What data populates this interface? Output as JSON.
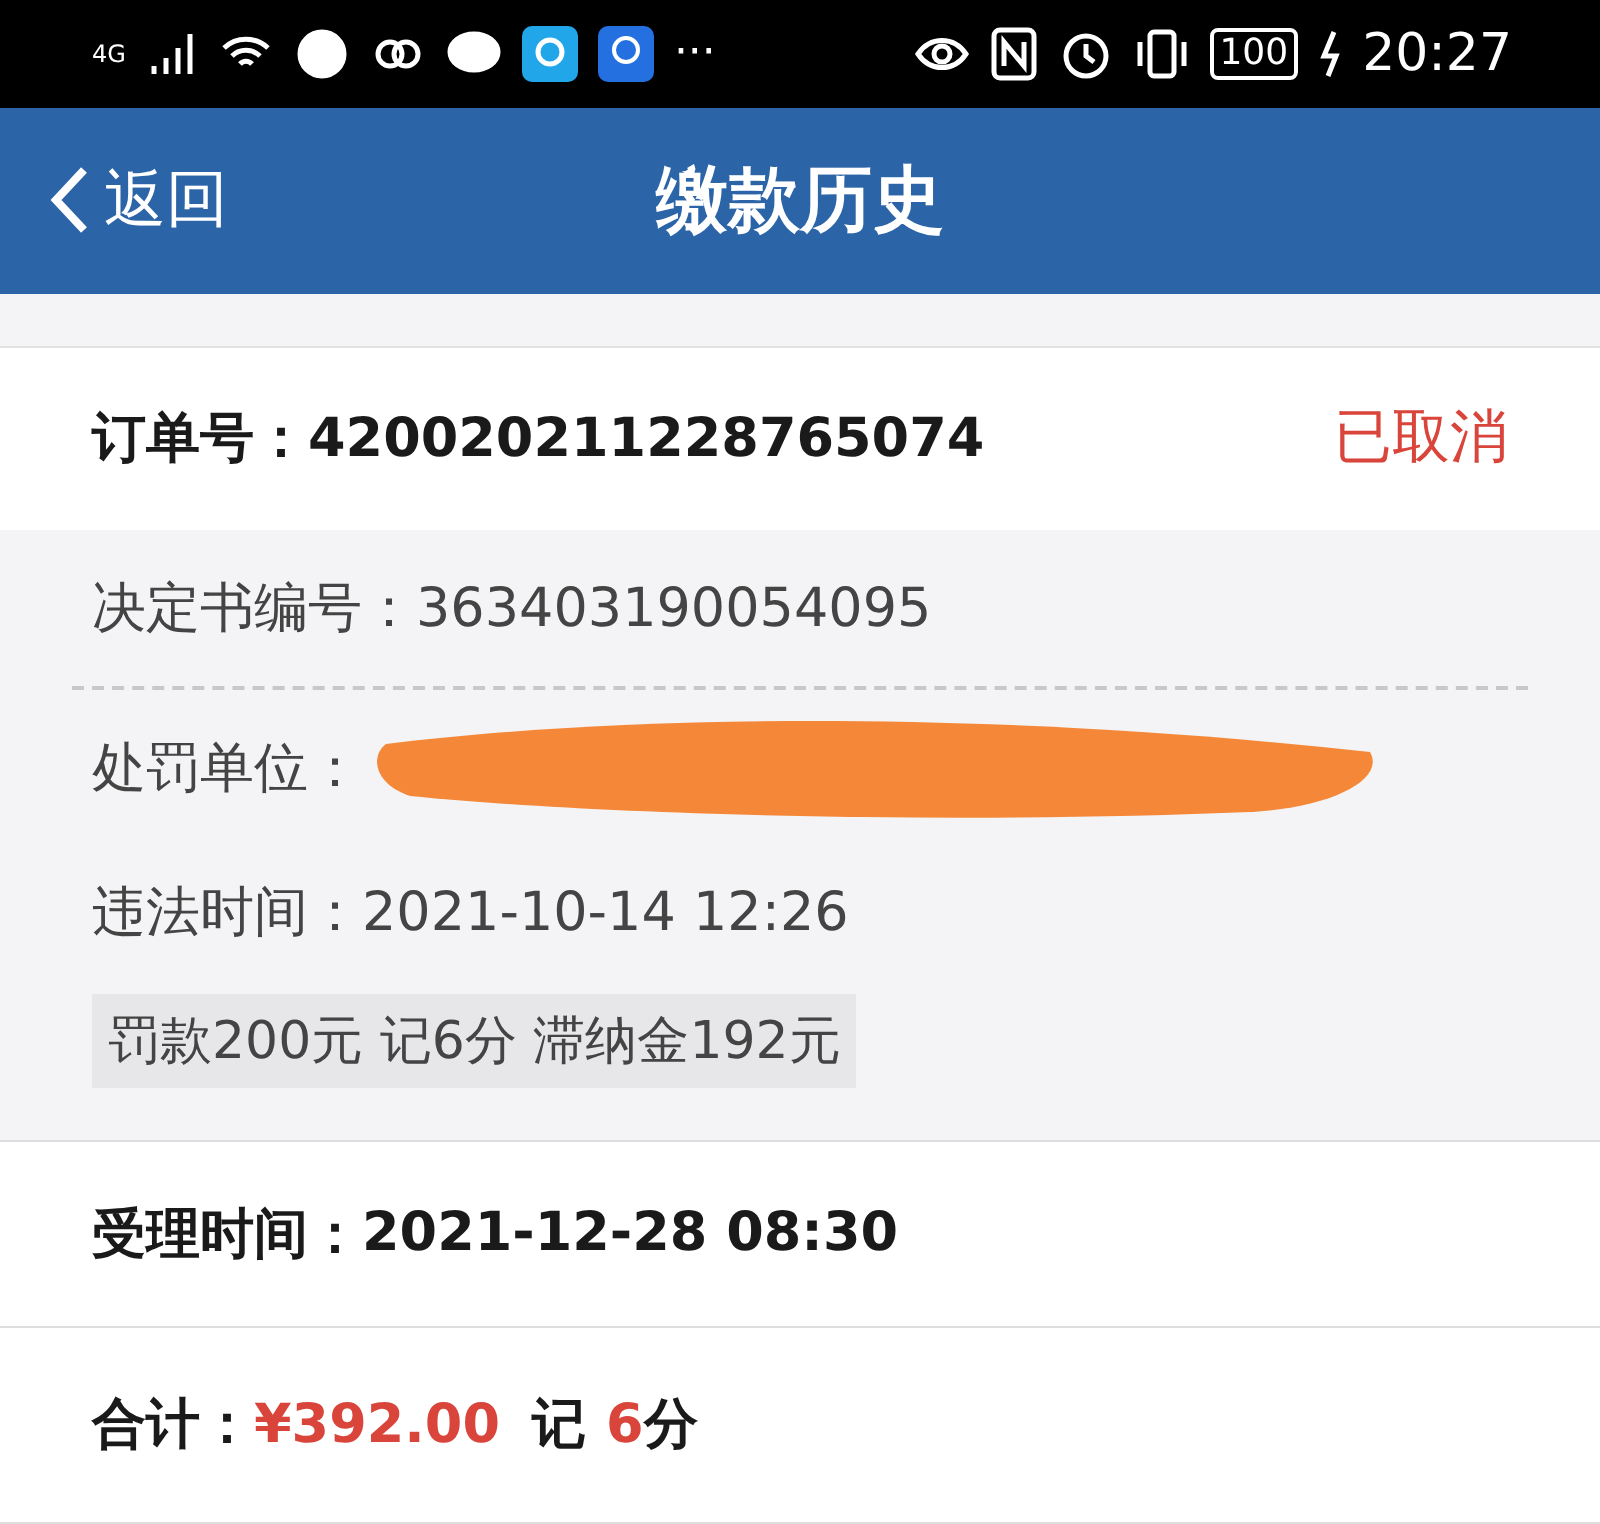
{
  "status_bar": {
    "network": "4G",
    "more": "···",
    "battery": "100",
    "time": "20:27"
  },
  "nav": {
    "back": "返回",
    "title": "缴款历史"
  },
  "order": {
    "label": "订单号：",
    "number": "420020211228765074",
    "status": "已取消"
  },
  "details": [
    {
      "kind": "text",
      "label": "决定书编号：",
      "value": "363403190054095"
    },
    {
      "kind": "redacted",
      "label": "处罚单位："
    },
    {
      "kind": "text",
      "label": "违法时间：",
      "value": "2021-10-14 12:26"
    }
  ],
  "summary_tag": "罚款200元 记6分 滞纳金192元",
  "accepted": {
    "label": "受理时间：",
    "value": "2021-12-28 08:30"
  },
  "total": {
    "label": "合计：",
    "amount": "¥392.00",
    "points_prefix": "记",
    "points": "6",
    "points_suffix": "分"
  }
}
